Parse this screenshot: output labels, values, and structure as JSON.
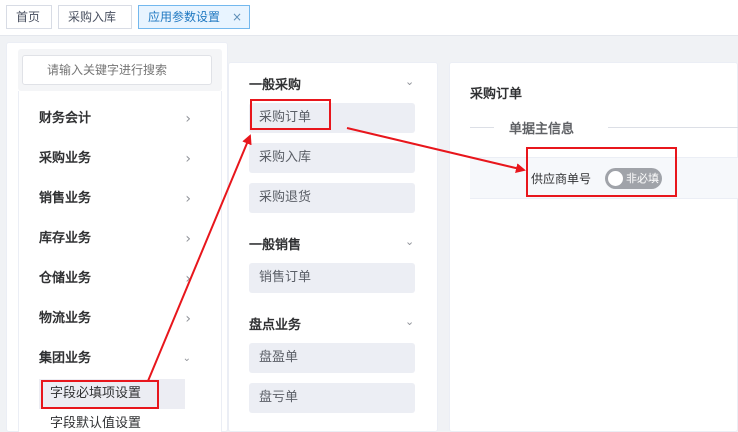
{
  "tabs": [
    {
      "label": "首页"
    },
    {
      "label": "采购入库"
    },
    {
      "label": "应用参数设置",
      "close": "×",
      "active": true
    }
  ],
  "search": {
    "placeholder": "请输入关键字进行搜索"
  },
  "left_menu": {
    "items": [
      {
        "label": "财务会计",
        "icon": "chevron-right-icon"
      },
      {
        "label": "采购业务",
        "icon": "chevron-right-icon"
      },
      {
        "label": "销售业务",
        "icon": "chevron-right-icon"
      },
      {
        "label": "库存业务",
        "icon": "chevron-right-icon"
      },
      {
        "label": "仓储业务",
        "icon": "chevron-right-icon"
      },
      {
        "label": "物流业务",
        "icon": "chevron-right-icon"
      },
      {
        "label": "集团业务",
        "icon": "chevron-down-icon"
      }
    ],
    "sub_items": [
      {
        "label": "字段必填项设置",
        "active": true
      },
      {
        "label": "字段默认值设置"
      }
    ]
  },
  "doc_groups": [
    {
      "title": "一般采购",
      "items": [
        "采购订单",
        "采购入库",
        "采购退货"
      ]
    },
    {
      "title": "一般销售",
      "items": [
        "销售订单"
      ]
    },
    {
      "title": "盘点业务",
      "items": [
        "盘盈单",
        "盘亏单"
      ]
    }
  ],
  "detail": {
    "title": "采购订单",
    "section": "单据主信息",
    "field": {
      "label": "供应商单号",
      "toggle_label": "非必填",
      "required": false
    }
  },
  "colors": {
    "accent_tab": "#1f78c1",
    "annotation_red": "#e8161c",
    "toggle_off": "#a0a3a9"
  }
}
